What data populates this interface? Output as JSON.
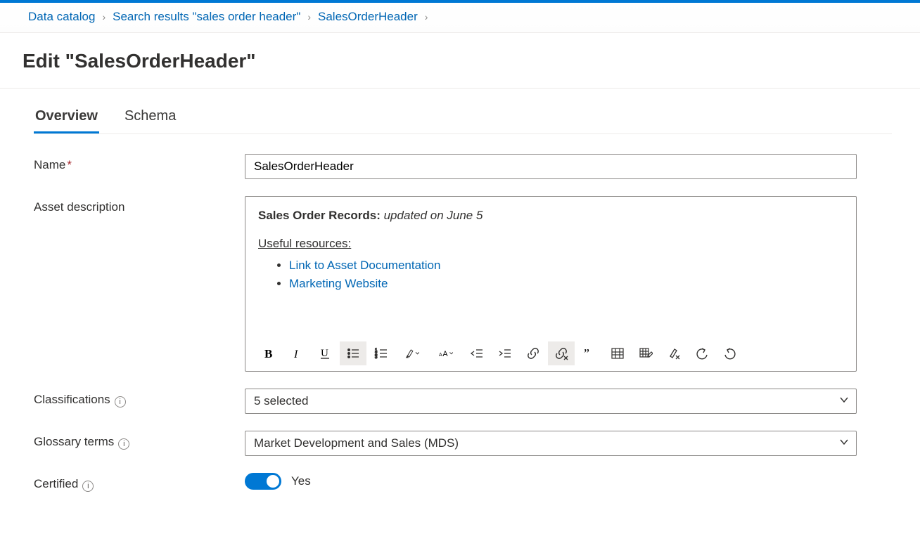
{
  "breadcrumb": {
    "items": [
      {
        "label": "Data catalog"
      },
      {
        "label": "Search results \"sales order header\""
      },
      {
        "label": "SalesOrderHeader"
      }
    ]
  },
  "pageTitle": "Edit \"SalesOrderHeader\"",
  "tabs": {
    "overview": "Overview",
    "schema": "Schema"
  },
  "fields": {
    "nameLabel": "Name",
    "nameValue": "SalesOrderHeader",
    "descLabel": "Asset description",
    "desc": {
      "headingBold": "Sales Order Records:",
      "headingItalic": " updated on June 5",
      "resourcesHeading": "Useful resources:",
      "links": [
        "Link to Asset Documentation",
        "Marketing Website"
      ]
    },
    "classificationsLabel": "Classifications",
    "classificationsValue": "5 selected",
    "glossaryLabel": "Glossary terms",
    "glossaryValue": "Market Development and Sales (MDS)",
    "certifiedLabel": "Certified",
    "certifiedValue": "Yes"
  },
  "toolbar": {
    "icons": [
      "bold-icon",
      "italic-icon",
      "underline-icon",
      "bulleted-list-icon",
      "numbered-list-icon",
      "highlight-color-icon",
      "font-size-icon",
      "outdent-icon",
      "indent-icon",
      "link-icon",
      "unlink-icon",
      "quote-icon",
      "insert-table-icon",
      "edit-table-icon",
      "clear-format-icon",
      "undo-icon",
      "redo-icon"
    ]
  }
}
